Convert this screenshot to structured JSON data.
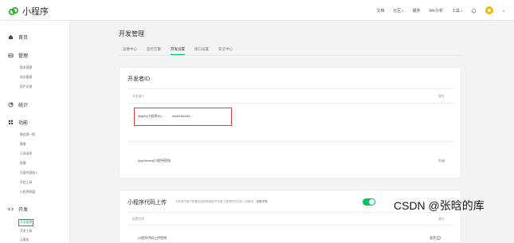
{
  "app": {
    "title": "小程序"
  },
  "topnav": [
    {
      "label": "文档",
      "caret": false
    },
    {
      "label": "社区",
      "caret": true
    },
    {
      "label": "服务",
      "caret": false
    },
    {
      "label": "We分析",
      "caret": false
    },
    {
      "label": "工具",
      "caret": true
    }
  ],
  "sidebar": {
    "home": "首页",
    "manage": {
      "label": "管理",
      "items": [
        "版本管理",
        "成员管理",
        "用户反馈"
      ]
    },
    "stats": "统计",
    "features": {
      "label": "功能",
      "items": [
        "微信搜一搜",
        "客服",
        "订阅消息",
        "直播",
        "页面内容接入",
        "实验工具",
        "小程序联盟"
      ]
    },
    "dev": {
      "label": "开发",
      "items": [
        "开发管理",
        "开发工具",
        "云服务"
      ]
    }
  },
  "page": {
    "title": "开发管理"
  },
  "tabs": [
    "运维中心",
    "监控告警",
    "开发设置",
    "接口设置",
    "安全中心"
  ],
  "active_tab_index": 2,
  "developer_id": {
    "title": "开发者ID",
    "col_id": "开发者ID",
    "col_op": "操作",
    "appid_label": "AppID(小程序ID)",
    "appid_value": "wxaf1f8c2d9...",
    "secret_label": "AppSecret(小程序密钥)",
    "secret_action": "生成"
  },
  "code_upload": {
    "title": "小程序代码上传",
    "hint": "开发者可基于配置信息调用微信开发者工具提供的代码上传模块。",
    "hint_link": "查看详情",
    "col_config": "配置信息",
    "col_op": "操作",
    "row_label": "小程序代码上传密钥",
    "row_status": "重置",
    "help": "?"
  },
  "watermark": "CSDN @张晗的库",
  "colors": {
    "accent": "#07c160",
    "highlight": "#e53935",
    "link": "#576b95"
  }
}
